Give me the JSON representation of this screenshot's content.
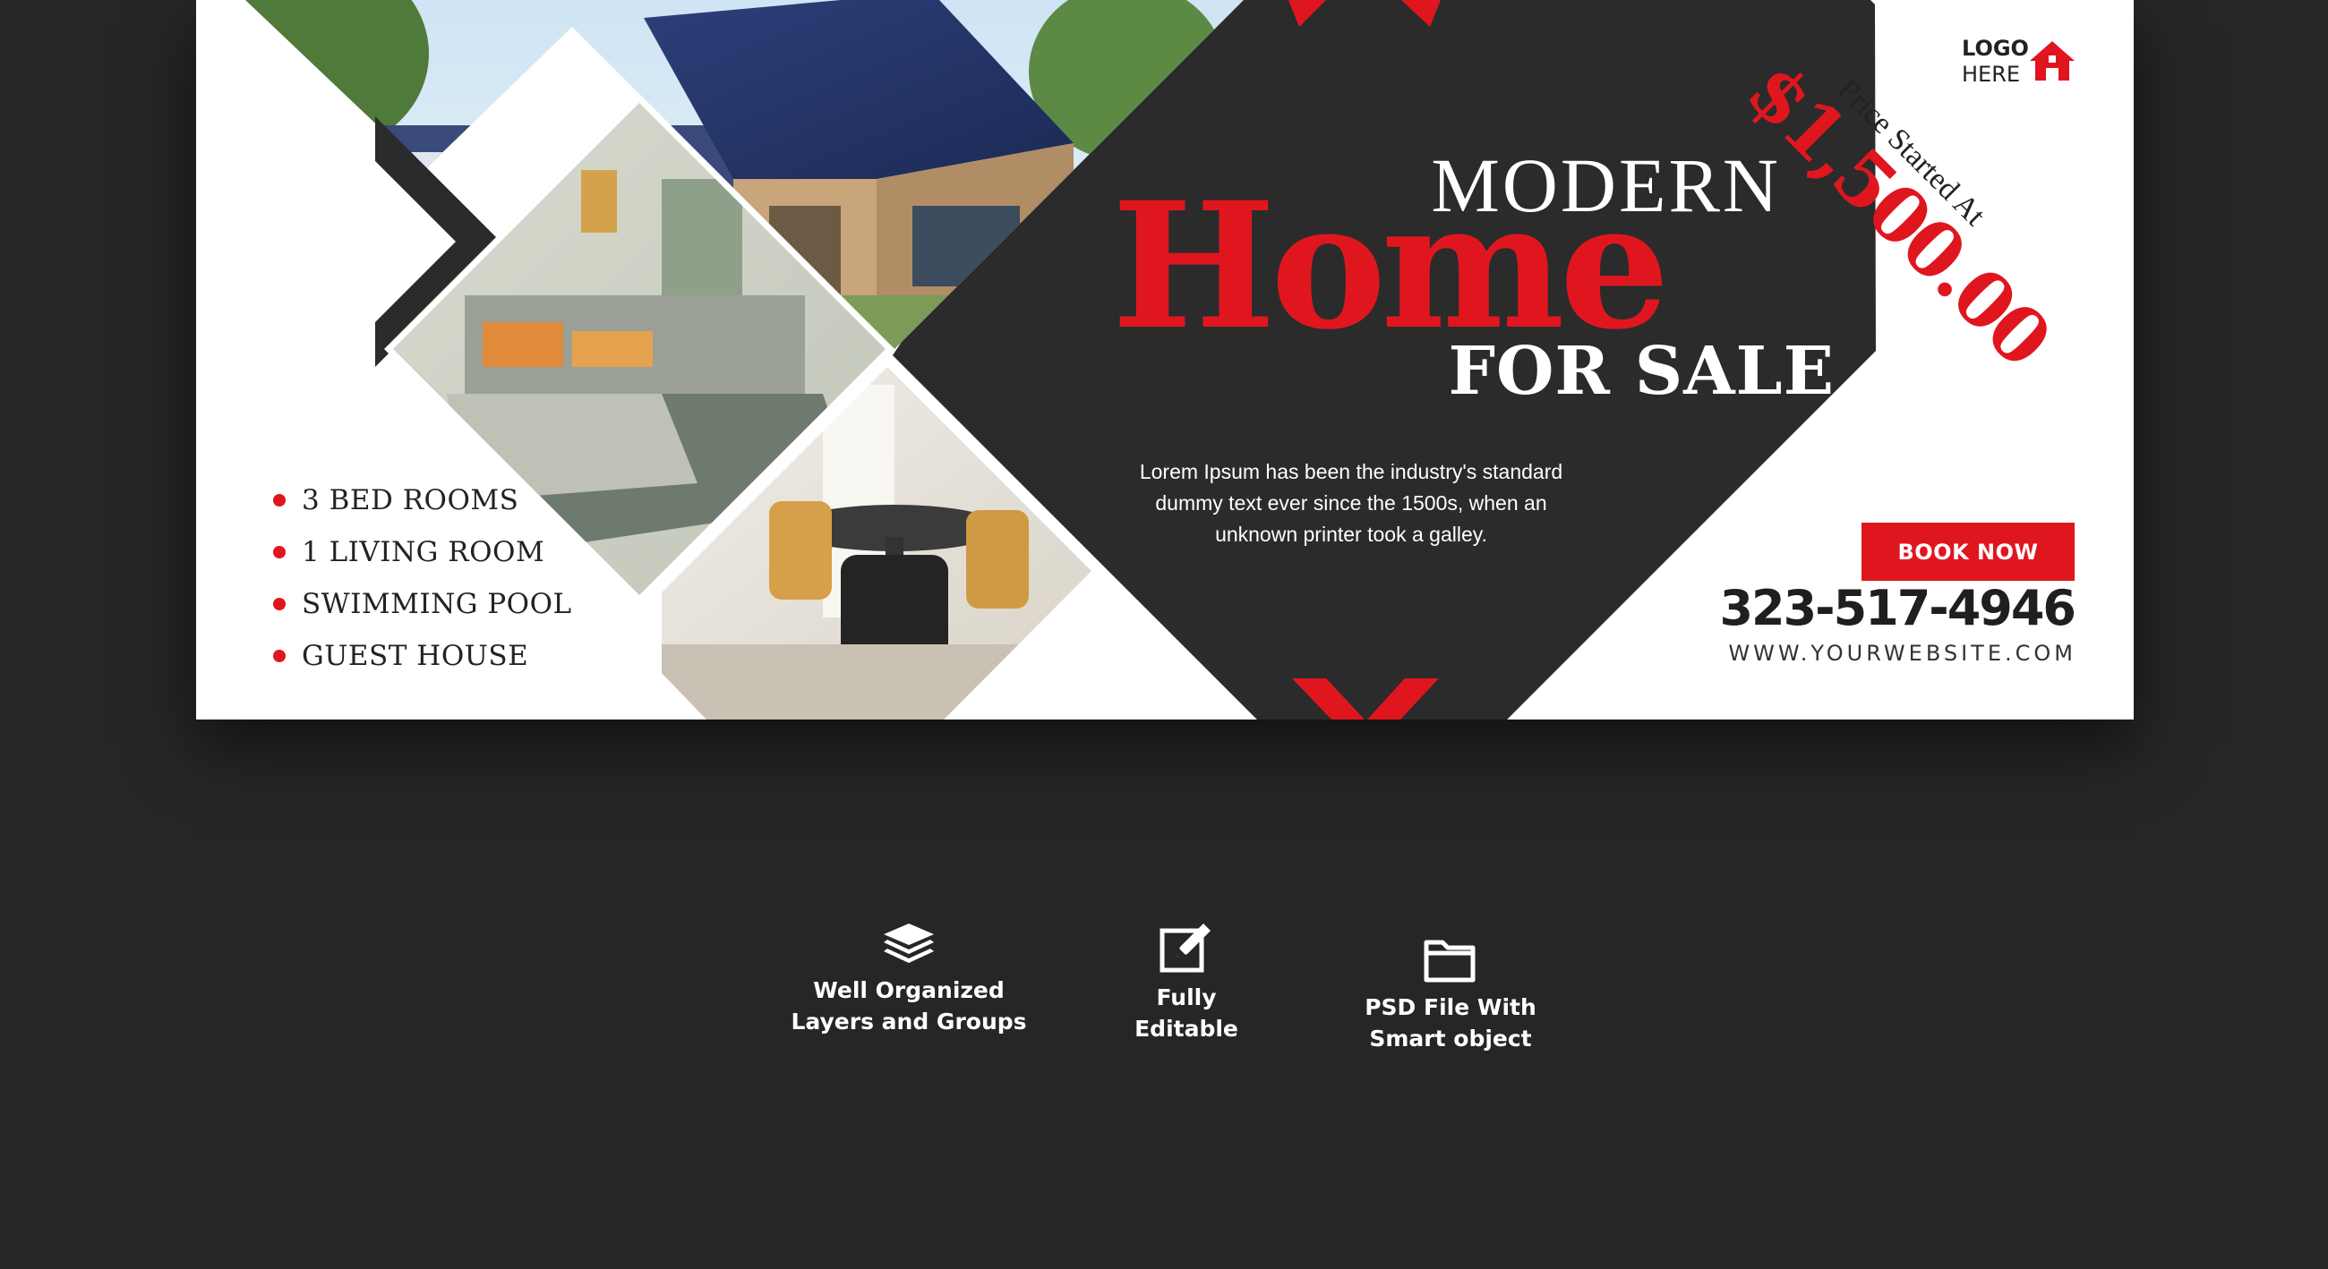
{
  "banner": {
    "title_top": "MODERN",
    "title_main": "Home",
    "title_bottom": "FOR SALE",
    "description": "Lorem Ipsum has been the industry's standard dummy text ever since the 1500s, when an unknown printer took a galley.",
    "price_label": "Price Started At",
    "price_value": "$1,500.00",
    "logo_line1": "LOGO",
    "logo_line2": "HERE",
    "logo_icon": "house-icon",
    "features": [
      "3 BED ROOMS",
      "1 LIVING ROOM",
      "SWIMMING POOL",
      "GUEST HOUSE"
    ],
    "book_button": "BOOK NOW",
    "phone": "323-517-4946",
    "website": "WWW.YOURWEBSITE.COM"
  },
  "badges": [
    {
      "icon": "layers-icon",
      "line1": "Well Organized",
      "line2": "Layers and Groups"
    },
    {
      "icon": "edit-icon",
      "line1": "Fully",
      "line2": "Editable"
    },
    {
      "icon": "folder-icon",
      "line1": "PSD File With",
      "line2": "Smart object"
    }
  ],
  "colors": {
    "page_background": "#262626",
    "accent_red": "#e0161f",
    "dark_panel": "#2b2b2b",
    "banner_background": "#ffffff"
  }
}
